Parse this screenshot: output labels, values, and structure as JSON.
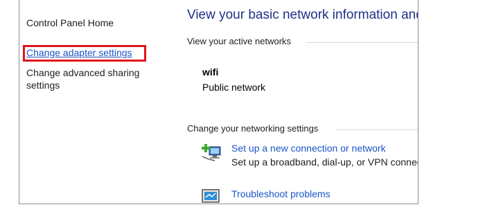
{
  "sidebar": {
    "home_label": "Control Panel Home",
    "adapter_link": "Change adapter settings",
    "advanced_link": "Change advanced sharing settings"
  },
  "main": {
    "title": "View your basic network information and set up connections",
    "active_networks_header": "View your active networks",
    "network": {
      "name": "wifi",
      "type": "Public network"
    },
    "networking_settings_header": "Change your networking settings",
    "tasks": [
      {
        "icon": "new-connection-icon",
        "link": "Set up a new connection or network",
        "description": "Set up a broadband, dial-up, or VPN connection; or set up a router or access point."
      },
      {
        "icon": "troubleshoot-icon",
        "link": "Troubleshoot problems",
        "description": ""
      }
    ]
  },
  "colors": {
    "link": "#1a55c8",
    "title": "#1e3287",
    "highlight": "#e0141e"
  }
}
